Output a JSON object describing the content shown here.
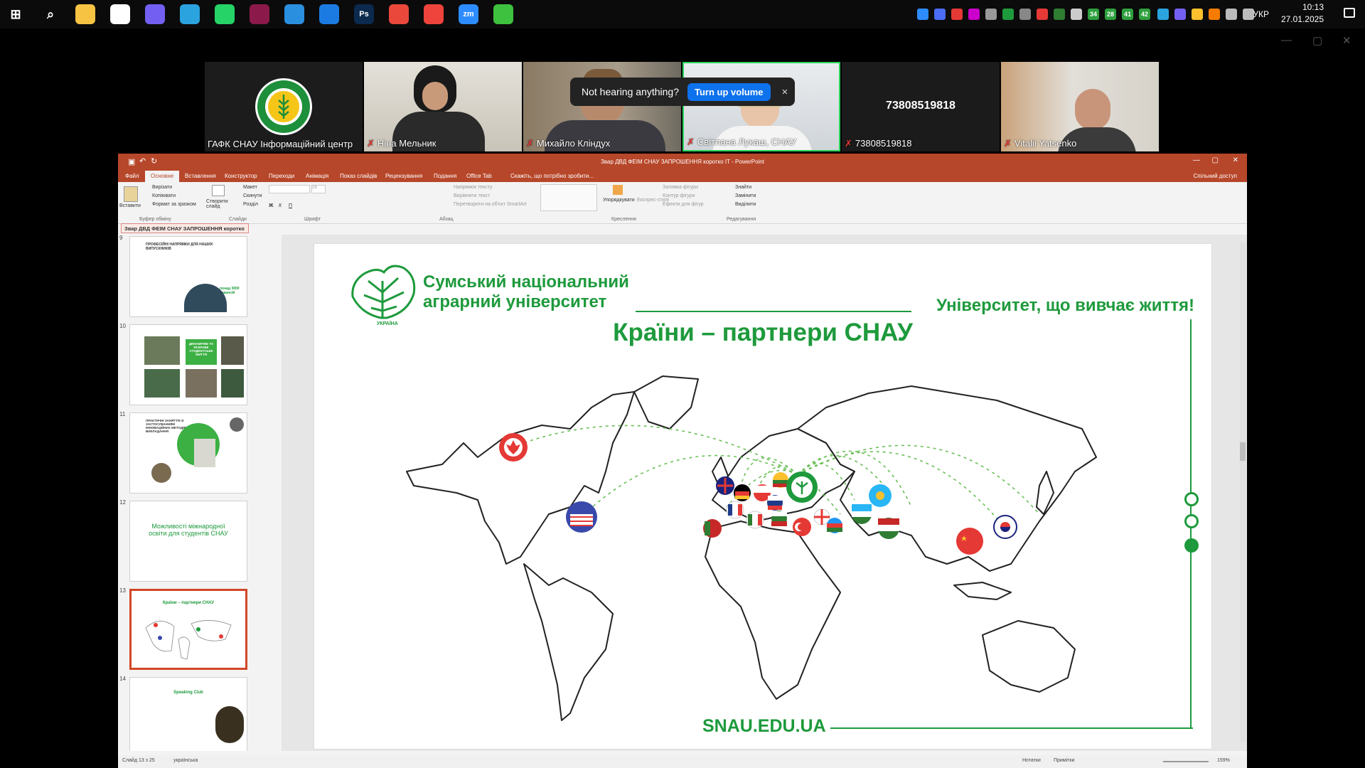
{
  "taskbar": {
    "apps": [
      {
        "name": "start",
        "label": "⊞",
        "color": "#ffffff"
      },
      {
        "name": "search",
        "label": "⌕",
        "color": "#ffffff"
      },
      {
        "name": "explorer",
        "label": "",
        "color": "#f6c343"
      },
      {
        "name": "store",
        "label": "",
        "color": "#ffffff"
      },
      {
        "name": "viber",
        "label": "",
        "color": "#7360f2"
      },
      {
        "name": "telegram",
        "label": "",
        "color": "#2aa3df"
      },
      {
        "name": "whatsapp",
        "label": "",
        "color": "#25d366"
      },
      {
        "name": "app-purple",
        "label": "",
        "color": "#8b1a4a"
      },
      {
        "name": "vscode",
        "label": "",
        "color": "#2b8fe0"
      },
      {
        "name": "firefox",
        "label": "",
        "color": "#1b7be3"
      },
      {
        "name": "photoshop",
        "label": "Ps",
        "color": "#0b2a4e"
      },
      {
        "name": "chrome",
        "label": "",
        "color": "#e9483b"
      },
      {
        "name": "anydesk",
        "label": "",
        "color": "#ef443b"
      },
      {
        "name": "zoom",
        "label": "zm",
        "color": "#2d8cff"
      },
      {
        "name": "camtasia",
        "label": "",
        "color": "#3ec13e"
      }
    ],
    "tray_numbers": [
      "34",
      "28",
      "41",
      "42"
    ],
    "language": "УКР",
    "time": "10:13",
    "date": "27.01.2025"
  },
  "zoom": {
    "tiles": [
      {
        "name": "ГАФК СНАУ Інформаційний центр",
        "muted": false,
        "type": "logo"
      },
      {
        "name": "Ніна Мельник",
        "muted": true,
        "type": "video"
      },
      {
        "name": "Михайло Кліндух",
        "muted": true,
        "type": "video"
      },
      {
        "name": "Світлана Лукаш, СНАУ",
        "muted": true,
        "type": "video"
      },
      {
        "name": "73808519818",
        "muted": true,
        "type": "number",
        "display": "73808519818"
      },
      {
        "name": "Vitalii Yatsenko",
        "muted": true,
        "type": "video"
      }
    ],
    "toast": {
      "text": "Not hearing anything?",
      "button": "Turn up volume",
      "close": "×"
    }
  },
  "ppt": {
    "title": "Звар ДВД ФЕІМ СНАУ ЗАПРОШЕННЯ коротко ІТ - PowerPoint",
    "tabs": [
      "Файл",
      "Основне",
      "Вставлення",
      "Конструктор",
      "Переходи",
      "Анімація",
      "Показ слайдів",
      "Рецензування",
      "Подання",
      "Office Tab"
    ],
    "active_tab": "Основне",
    "tell_me": "Скажіть, що потрібно зробити...",
    "share": "Спільний доступ",
    "ribbon": {
      "clipboard": {
        "paste": "Вставити",
        "cut": "Вирізати",
        "copy": "Копіювати",
        "format": "Формат за зразком",
        "group": "Буфер обміну"
      },
      "slides": {
        "new": "Створити слайд",
        "layout": "Макет",
        "reset": "Скинути",
        "section": "Розділ",
        "group": "Слайди"
      },
      "font": {
        "group": "Шрифт",
        "size": "16"
      },
      "paragraph": {
        "direction": "Напрямок тексту",
        "align": "Вирівняти текст",
        "smartart": "Перетворити на об'єкт SmartArt",
        "group": "Абзац"
      },
      "drawing": {
        "arrange": "Упорядкувати",
        "styles": "Експрес-стилі",
        "fill": "Заливка фігури",
        "outline": "Контур фігури",
        "effects": "Ефекти для фігур",
        "group": "Креслення"
      },
      "editing": {
        "find": "Знайти",
        "replace": "Замінити",
        "select": "Виділити",
        "group": "Редагування"
      }
    },
    "doc_tab": "Звар ДВД ФЕІМ СНАУ ЗАПРОШЕННЯ коротко ІТ",
    "thumbnails": [
      {
        "num": "9",
        "title": "ПРОФЕСІЙНІ НАПРЯМКИ ДЛЯ НАШИХ ВИПУСКНИКІВ",
        "note": "понад 3000 вакансій"
      },
      {
        "num": "10",
        "title": "ДИНАМІЧНЕ ТА ЯСКРАВЕ СТУДЕНТСЬКЕ ЖИТТЯ",
        "note": ""
      },
      {
        "num": "11",
        "title": "ПРАКТИЧНІ ЗАНЯТТЯ ІЗ ЗАСТОСУВАННЯМ ІННОВАЦІЙНИХ МЕТОДІВ ВИКЛАДАННЯ",
        "note": ""
      },
      {
        "num": "12",
        "title": "Можливості міжнародної освіти для студентів СНАУ",
        "note": ""
      },
      {
        "num": "13",
        "title": "Країни – партнери СНАУ",
        "note": ""
      },
      {
        "num": "14",
        "title": "Speaking Club",
        "note": ""
      }
    ],
    "selected_thumb": "13",
    "status": {
      "slide": "Слайд 13 з 25",
      "lang": "українська",
      "notes": "Нотатки",
      "comments": "Примітки",
      "zoom": "159%"
    }
  },
  "slide": {
    "uni_line1": "Сумський національний",
    "uni_line2": "аграрний університет",
    "motto": "Університет, що вивчає життя!",
    "title": "Країни – партнери СНАУ",
    "logo_word": "УКРАЇНА",
    "site": "SNAU.EDU.UA",
    "accent": "#1e9a3c",
    "partner_pins": [
      "Canada",
      "USA",
      "United Kingdom",
      "Germany",
      "France",
      "Italy",
      "Portugal",
      "Poland",
      "Slovakia",
      "Bulgaria",
      "Lithuania",
      "Georgia",
      "Turkey",
      "Azerbaijan",
      "Uzbekistan",
      "Kazakhstan",
      "Tajikistan",
      "China",
      "South Korea"
    ]
  }
}
